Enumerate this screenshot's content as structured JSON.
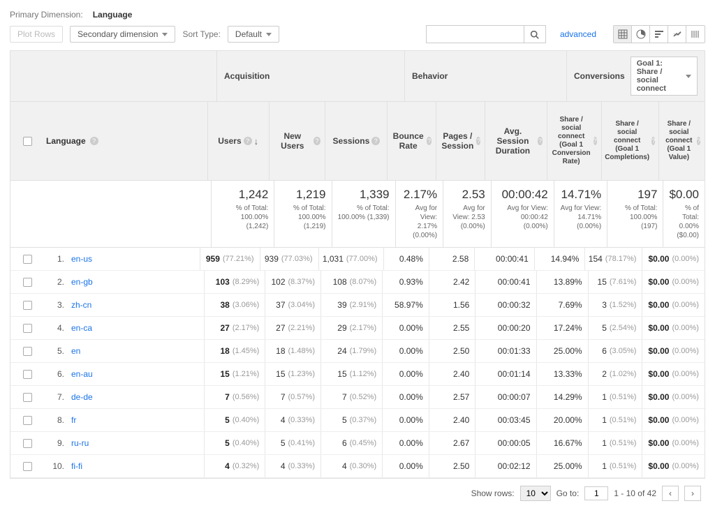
{
  "primaryDimension": {
    "label": "Primary Dimension:",
    "value": "Language"
  },
  "toolbar": {
    "plotRows": "Plot Rows",
    "secondaryDim": "Secondary dimension",
    "sortTypeLabel": "Sort Type:",
    "sortTypeValue": "Default",
    "advanced": "advanced",
    "searchPlaceholder": ""
  },
  "groups": {
    "acq": "Acquisition",
    "beh": "Behavior",
    "conv": "Conversions",
    "goal": "Goal 1: Share / social connect"
  },
  "headers": {
    "dimension": "Language",
    "users": "Users",
    "newUsers": "New Users",
    "sessions": "Sessions",
    "bounce": "Bounce Rate",
    "pps": "Pages / Session",
    "asd": "Avg. Session Duration",
    "cr": "Share / social connect (Goal 1 Conversion Rate)",
    "comp": "Share / social connect (Goal 1 Completions)",
    "val": "Share / social connect (Goal 1 Value)"
  },
  "totals": {
    "users": {
      "v": "1,242",
      "sub": "% of Total: 100.00% (1,242)"
    },
    "newUsers": {
      "v": "1,219",
      "sub": "% of Total: 100.00% (1,219)"
    },
    "sessions": {
      "v": "1,339",
      "sub": "% of Total: 100.00% (1,339)"
    },
    "bounce": {
      "v": "2.17%",
      "sub": "Avg for View: 2.17% (0.00%)"
    },
    "pps": {
      "v": "2.53",
      "sub": "Avg for View: 2.53 (0.00%)"
    },
    "asd": {
      "v": "00:00:42",
      "sub": "Avg for View: 00:00:42 (0.00%)"
    },
    "cr": {
      "v": "14.71%",
      "sub": "Avg for View: 14.71% (0.00%)"
    },
    "comp": {
      "v": "197",
      "sub": "% of Total: 100.00% (197)"
    },
    "val": {
      "v": "$0.00",
      "sub": "% of Total: 0.00% ($0.00)"
    }
  },
  "rows": [
    {
      "idx": "1.",
      "lang": "en-us",
      "users": "959",
      "usersPct": "(77.21%)",
      "new": "939",
      "newPct": "(77.03%)",
      "sess": "1,031",
      "sessPct": "(77.00%)",
      "bounce": "0.48%",
      "pps": "2.58",
      "asd": "00:00:41",
      "cr": "14.94%",
      "comp": "154",
      "compPct": "(78.17%)",
      "val": "$0.00",
      "valPct": "(0.00%)"
    },
    {
      "idx": "2.",
      "lang": "en-gb",
      "users": "103",
      "usersPct": "(8.29%)",
      "new": "102",
      "newPct": "(8.37%)",
      "sess": "108",
      "sessPct": "(8.07%)",
      "bounce": "0.93%",
      "pps": "2.42",
      "asd": "00:00:41",
      "cr": "13.89%",
      "comp": "15",
      "compPct": "(7.61%)",
      "val": "$0.00",
      "valPct": "(0.00%)"
    },
    {
      "idx": "3.",
      "lang": "zh-cn",
      "users": "38",
      "usersPct": "(3.06%)",
      "new": "37",
      "newPct": "(3.04%)",
      "sess": "39",
      "sessPct": "(2.91%)",
      "bounce": "58.97%",
      "pps": "1.56",
      "asd": "00:00:32",
      "cr": "7.69%",
      "comp": "3",
      "compPct": "(1.52%)",
      "val": "$0.00",
      "valPct": "(0.00%)"
    },
    {
      "idx": "4.",
      "lang": "en-ca",
      "users": "27",
      "usersPct": "(2.17%)",
      "new": "27",
      "newPct": "(2.21%)",
      "sess": "29",
      "sessPct": "(2.17%)",
      "bounce": "0.00%",
      "pps": "2.55",
      "asd": "00:00:20",
      "cr": "17.24%",
      "comp": "5",
      "compPct": "(2.54%)",
      "val": "$0.00",
      "valPct": "(0.00%)"
    },
    {
      "idx": "5.",
      "lang": "en",
      "users": "18",
      "usersPct": "(1.45%)",
      "new": "18",
      "newPct": "(1.48%)",
      "sess": "24",
      "sessPct": "(1.79%)",
      "bounce": "0.00%",
      "pps": "2.50",
      "asd": "00:01:33",
      "cr": "25.00%",
      "comp": "6",
      "compPct": "(3.05%)",
      "val": "$0.00",
      "valPct": "(0.00%)"
    },
    {
      "idx": "6.",
      "lang": "en-au",
      "users": "15",
      "usersPct": "(1.21%)",
      "new": "15",
      "newPct": "(1.23%)",
      "sess": "15",
      "sessPct": "(1.12%)",
      "bounce": "0.00%",
      "pps": "2.40",
      "asd": "00:01:14",
      "cr": "13.33%",
      "comp": "2",
      "compPct": "(1.02%)",
      "val": "$0.00",
      "valPct": "(0.00%)"
    },
    {
      "idx": "7.",
      "lang": "de-de",
      "users": "7",
      "usersPct": "(0.56%)",
      "new": "7",
      "newPct": "(0.57%)",
      "sess": "7",
      "sessPct": "(0.52%)",
      "bounce": "0.00%",
      "pps": "2.57",
      "asd": "00:00:07",
      "cr": "14.29%",
      "comp": "1",
      "compPct": "(0.51%)",
      "val": "$0.00",
      "valPct": "(0.00%)"
    },
    {
      "idx": "8.",
      "lang": "fr",
      "users": "5",
      "usersPct": "(0.40%)",
      "new": "4",
      "newPct": "(0.33%)",
      "sess": "5",
      "sessPct": "(0.37%)",
      "bounce": "0.00%",
      "pps": "2.40",
      "asd": "00:03:45",
      "cr": "20.00%",
      "comp": "1",
      "compPct": "(0.51%)",
      "val": "$0.00",
      "valPct": "(0.00%)"
    },
    {
      "idx": "9.",
      "lang": "ru-ru",
      "users": "5",
      "usersPct": "(0.40%)",
      "new": "5",
      "newPct": "(0.41%)",
      "sess": "6",
      "sessPct": "(0.45%)",
      "bounce": "0.00%",
      "pps": "2.67",
      "asd": "00:00:05",
      "cr": "16.67%",
      "comp": "1",
      "compPct": "(0.51%)",
      "val": "$0.00",
      "valPct": "(0.00%)"
    },
    {
      "idx": "10.",
      "lang": "fi-fi",
      "users": "4",
      "usersPct": "(0.32%)",
      "new": "4",
      "newPct": "(0.33%)",
      "sess": "4",
      "sessPct": "(0.30%)",
      "bounce": "0.00%",
      "pps": "2.50",
      "asd": "00:02:12",
      "cr": "25.00%",
      "comp": "1",
      "compPct": "(0.51%)",
      "val": "$0.00",
      "valPct": "(0.00%)"
    }
  ],
  "pager": {
    "showRowsLabel": "Show rows:",
    "gotoLabel": "Go to:",
    "showRows": "10",
    "goto": "1",
    "range": "1 - 10 of 42"
  }
}
